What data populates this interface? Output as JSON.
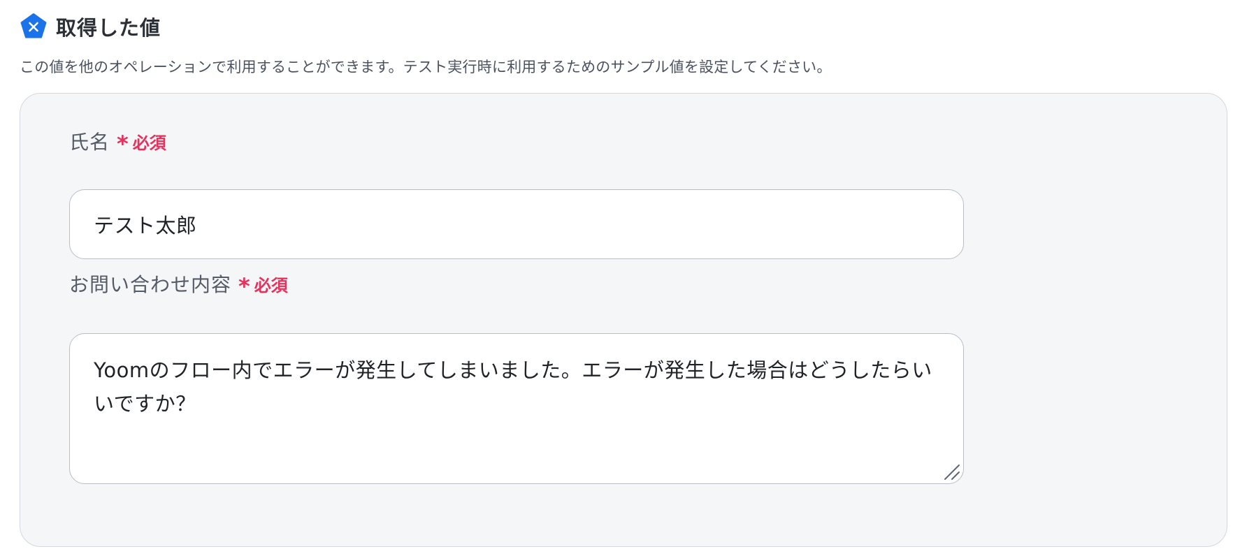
{
  "section": {
    "icon": "variable-x-icon",
    "title": "取得した値",
    "description": "この値を他のオペレーションで利用することができます。テスト実行時に利用するためのサンプル値を設定してください。"
  },
  "fields": [
    {
      "label": "氏名",
      "required_mark": "*",
      "required_text": "必須",
      "value": "テスト太郎"
    },
    {
      "label": "お問い合わせ内容",
      "required_mark": "*",
      "required_text": "必須",
      "value": "Yoomのフロー内でエラーが発生してしまいました。エラーが発生した場合はどうしたらいいですか？"
    }
  ],
  "colors": {
    "badge": "#1a73e8",
    "required": "#e8305c",
    "panel_bg": "#f5f6f8"
  }
}
